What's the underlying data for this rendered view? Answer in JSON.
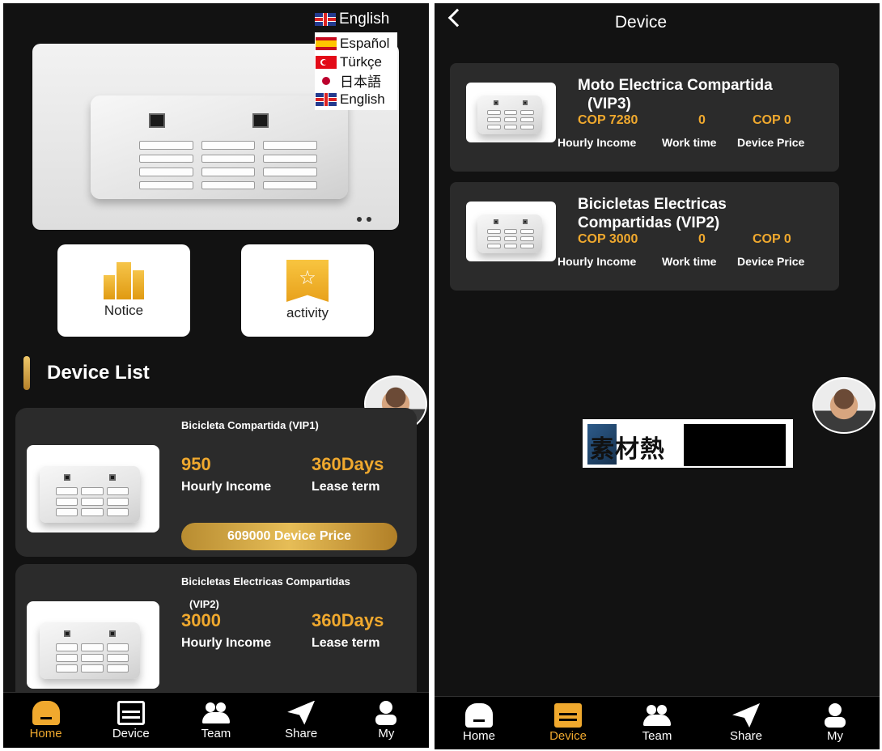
{
  "home": {
    "language": {
      "current": "English",
      "options": [
        {
          "label": "Español",
          "flag": "es-flag-icon"
        },
        {
          "label": "Türkçe",
          "flag": "tr-flag-icon"
        },
        {
          "label": "日本語",
          "flag": "jp-flag-icon"
        },
        {
          "label": "English",
          "flag": "uk-flag-icon"
        }
      ]
    },
    "banner": {
      "slides": 2,
      "active_slide": 1
    },
    "tiles": {
      "notice": "Notice",
      "activity": "activity"
    },
    "section_title": "Device List",
    "cards": [
      {
        "name": "Bicicleta Compartida  (VIP1)",
        "income_value": "950",
        "income_label": "Hourly Income",
        "term_value": "360Days",
        "term_label": "Lease term",
        "price_button": "609000 Device Price"
      },
      {
        "name": "Bicicletas Electricas Compartidas",
        "tier": "(VIP2)",
        "income_value": "3000",
        "income_label": "Hourly Income",
        "term_value": "360Days",
        "term_label": "Lease term"
      }
    ]
  },
  "device_page": {
    "title": "Device",
    "devices": [
      {
        "name": "Moto Electrica Compartida",
        "tier": "(VIP3)",
        "income_value": "COP 7280",
        "work_time_value": "0",
        "price_value": "COP 0",
        "income_label": "Hourly Income",
        "work_time_label": "Work time",
        "price_label": "Device Price"
      },
      {
        "name": "Bicicletas Electricas",
        "tier": "Compartidas  (VIP2)",
        "income_value": "COP 3000",
        "work_time_value": "0",
        "price_value": "COP 0",
        "income_label": "Hourly Income",
        "work_time_label": "Work time",
        "price_label": "Device Price"
      }
    ],
    "watermark_text": "素材熱"
  },
  "tabbar_home": {
    "active": "Home",
    "tabs": [
      {
        "label": "Home",
        "icon": "home-icon"
      },
      {
        "label": "Device",
        "icon": "device-icon"
      },
      {
        "label": "Team",
        "icon": "team-icon"
      },
      {
        "label": "Share",
        "icon": "share-icon"
      },
      {
        "label": "My",
        "icon": "user-icon"
      }
    ]
  },
  "tabbar_device": {
    "active": "Device",
    "tabs": [
      {
        "label": "Home",
        "icon": "home-icon"
      },
      {
        "label": "Device",
        "icon": "device-icon"
      },
      {
        "label": "Team",
        "icon": "team-icon"
      },
      {
        "label": "Share",
        "icon": "share-icon"
      },
      {
        "label": "My",
        "icon": "user-icon"
      }
    ]
  },
  "colors": {
    "accent": "#f0a92e",
    "background": "#121212",
    "card": "#2b2b2b"
  }
}
